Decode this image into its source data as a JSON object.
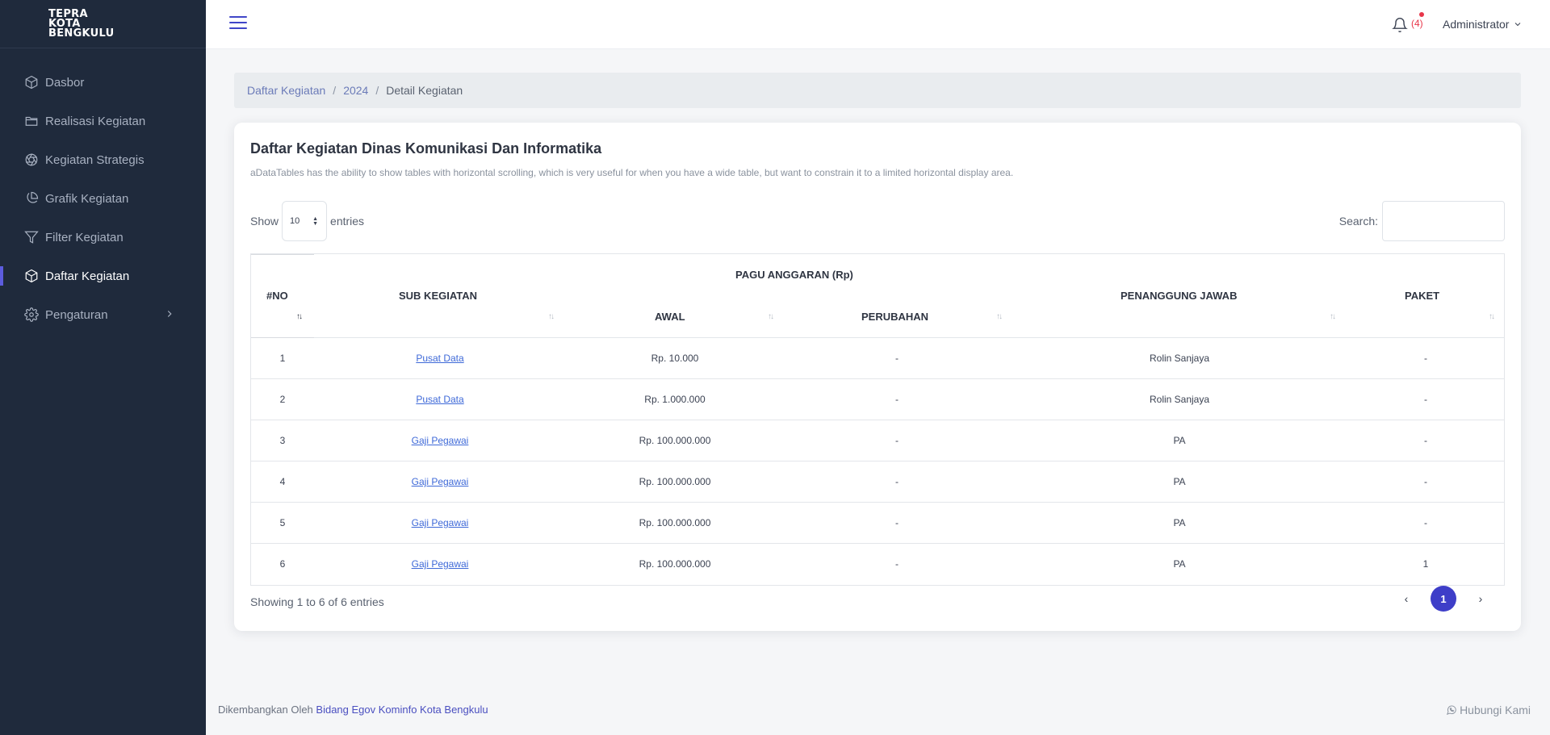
{
  "brand": {
    "line1": "TEPRA",
    "line2": "KOTA",
    "line3": "BENGKULU"
  },
  "sidebar": {
    "items": [
      {
        "label": "Dasbor",
        "icon": "cube-icon"
      },
      {
        "label": "Realisasi Kegiatan",
        "icon": "folder-icon"
      },
      {
        "label": "Kegiatan Strategis",
        "icon": "aperture-icon"
      },
      {
        "label": "Grafik Kegiatan",
        "icon": "pie-chart-icon"
      },
      {
        "label": "Filter Kegiatan",
        "icon": "filter-icon"
      },
      {
        "label": "Daftar Kegiatan",
        "icon": "cube-icon",
        "active": true
      },
      {
        "label": "Pengaturan",
        "icon": "gear-icon"
      }
    ]
  },
  "topbar": {
    "notification_count": "(4)",
    "user_name": "Administrator"
  },
  "breadcrumb": {
    "items": [
      "Daftar Kegiatan",
      "2024"
    ],
    "current": "Detail Kegiatan"
  },
  "card": {
    "title": "Daftar Kegiatan Dinas Komunikasi Dan Informatika",
    "description": "aDataTables has the ability to show tables with horizontal scrolling, which is very useful for when you have a wide table, but want to constrain it to a limited horizontal display area."
  },
  "table_controls": {
    "show_label": "Show",
    "entries_value": "10",
    "entries_label": "entries",
    "search_label": "Search:"
  },
  "table": {
    "headers": {
      "no": "#NO",
      "sub_kegiatan": "SUB KEGIATAN",
      "pagu": "PAGU ANGGARAN (Rp)",
      "awal": "AWAL",
      "perubahan": "PERUBAHAN",
      "penanggung": "PENANGGUNG JAWAB",
      "paket": "PAKET"
    },
    "rows": [
      {
        "no": "1",
        "sub": "Pusat Data",
        "awal": "Rp. 10.000",
        "perubahan": "-",
        "pj": "Rolin Sanjaya",
        "paket": "-"
      },
      {
        "no": "2",
        "sub": "Pusat Data",
        "awal": "Rp. 1.000.000",
        "perubahan": "-",
        "pj": "Rolin Sanjaya",
        "paket": "-"
      },
      {
        "no": "3",
        "sub": "Gaji Pegawai",
        "awal": "Rp. 100.000.000",
        "perubahan": "-",
        "pj": "PA",
        "paket": "-"
      },
      {
        "no": "4",
        "sub": "Gaji Pegawai",
        "awal": "Rp. 100.000.000",
        "perubahan": "-",
        "pj": "PA",
        "paket": "-"
      },
      {
        "no": "5",
        "sub": "Gaji Pegawai",
        "awal": "Rp. 100.000.000",
        "perubahan": "-",
        "pj": "PA",
        "paket": "-"
      },
      {
        "no": "6",
        "sub": "Gaji Pegawai",
        "awal": "Rp. 100.000.000",
        "perubahan": "-",
        "pj": "PA",
        "paket": "1"
      }
    ]
  },
  "pagination": {
    "info": "Showing 1 to 6 of 6 entries",
    "prev": "‹",
    "current_page": "1",
    "next": "›"
  },
  "footer": {
    "prefix": "Dikembangkan Oleh ",
    "link": "Bidang Egov Kominfo Kota Bengkulu",
    "contact": "Hubungi Kami"
  },
  "colors": {
    "sidebar_bg": "#1f2a3c",
    "accent": "#3e3ec8",
    "link": "#3e69d8",
    "notification": "#e8364a"
  }
}
